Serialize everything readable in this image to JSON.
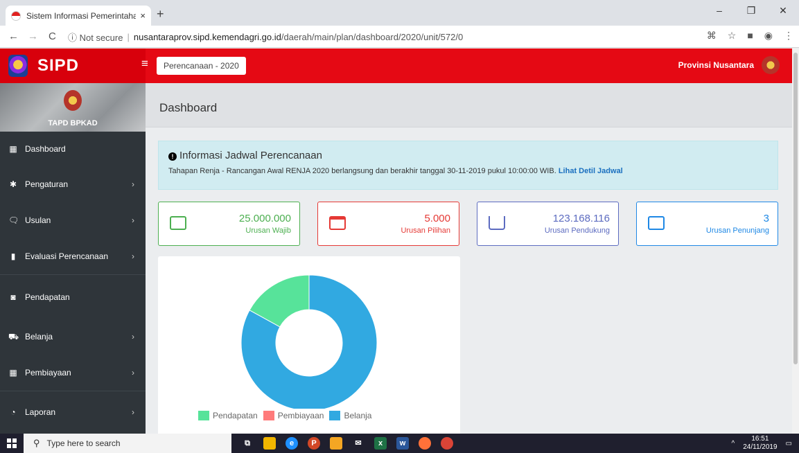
{
  "browser": {
    "tab_title": "Sistem Informasi Pemerintahan D",
    "tab_close": "×",
    "new_tab": "+",
    "win_min": "–",
    "win_max": "❐",
    "win_close": "✕",
    "back": "←",
    "forward": "→",
    "reload": "C",
    "not_secure": "ⓘ Not secure",
    "url_host": "nusantaraprov.sipd.kemendagri.go.id",
    "url_path": "/daerah/main/plan/dashboard/2020/unit/572/0"
  },
  "header": {
    "brand": "SIPD",
    "period_button": "Perencanaan - 2020",
    "province": "Provinsi Nusantara"
  },
  "sidebar": {
    "profile_name": "TAPD BPKAD",
    "items": [
      {
        "label": "Dashboard",
        "icon": "dashboard-icon",
        "glyph": "▦"
      },
      {
        "label": "Pengaturan",
        "icon": "gear-icon",
        "glyph": "✱"
      },
      {
        "label": "Usulan",
        "icon": "comment-icon",
        "glyph": "🗨"
      },
      {
        "label": "Evaluasi Perencanaan",
        "icon": "bookmark-icon",
        "glyph": "▮"
      },
      {
        "label": "Pendapatan",
        "icon": "wallet-icon",
        "glyph": "◙"
      },
      {
        "label": "Belanja",
        "icon": "cart-icon",
        "glyph": "⛟"
      },
      {
        "label": "Pembiayaan",
        "icon": "calculator-icon",
        "glyph": "▦"
      },
      {
        "label": "Laporan",
        "icon": "pie-chart-icon",
        "glyph": "◔"
      }
    ],
    "chevron": "›"
  },
  "main": {
    "title": "Dashboard",
    "alert": {
      "heading": "Informasi Jadwal Perencanaan",
      "body": "Tahapan Renja - Rancangan Awal RENJA 2020 berlangsung dan berakhir tanggal 30-11-2019 pukul 10:00:00 WIB.",
      "link": "Lihat Detil Jadwal"
    },
    "cards": [
      {
        "value": "25.000.000",
        "label": "Urusan Wajib",
        "color": "#4caf50"
      },
      {
        "value": "5.000",
        "label": "Urusan Pilihan",
        "color": "#e53935"
      },
      {
        "value": "123.168.116",
        "label": "Urusan Pendukung",
        "color": "#5c6bc0"
      },
      {
        "value": "3",
        "label": "Urusan Penunjang",
        "color": "#1e88e5"
      }
    ]
  },
  "chart_data": {
    "type": "pie",
    "categories": [
      "Pendapatan",
      "Pembiayaan",
      "Belanja"
    ],
    "values": [
      17,
      0,
      83
    ],
    "colors": [
      "#57e39a",
      "#ff7b7b",
      "#31a9e1"
    ],
    "donut": true,
    "legend": "bottom"
  },
  "taskbar": {
    "search_placeholder": "Type here to search",
    "time": "16:51",
    "date": "24/11/2019"
  }
}
